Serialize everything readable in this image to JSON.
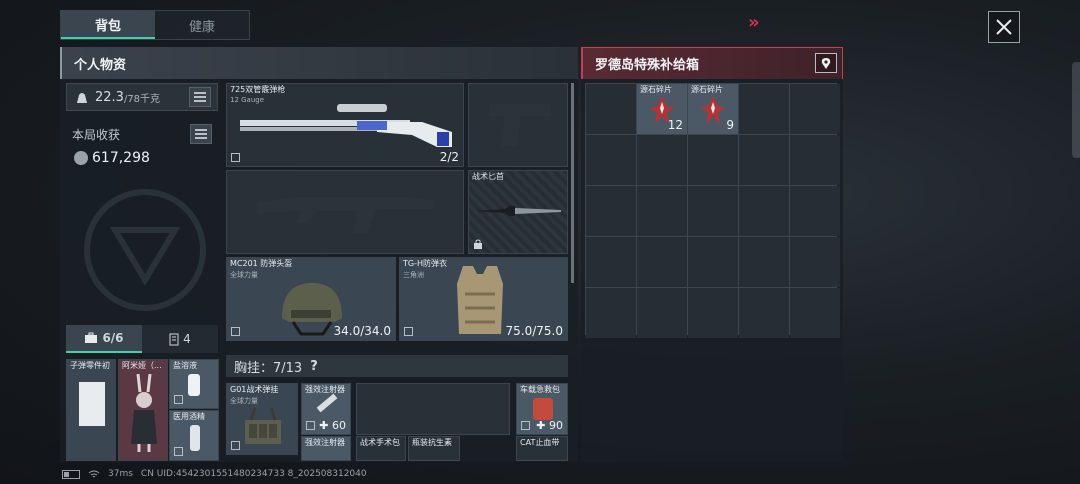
{
  "tabs": [
    {
      "label": "背包"
    },
    {
      "label": "健康"
    }
  ],
  "left_panel": {
    "title": "个人物资",
    "weight_value": "22.3",
    "weight_max": "/78千克",
    "harvest_label": "本局收获",
    "money": "617,298",
    "weapon1": {
      "name": "725双管霰弹枪",
      "sub": "12 Gauge",
      "value": "2/2"
    },
    "knife": {
      "name": "战术匕首"
    },
    "helmet": {
      "name": "MC201 防弹头盔",
      "sub": "全球力量",
      "value": "34.0/34.0"
    },
    "armor": {
      "name": "TG-H防弹衣",
      "sub": "三角洲",
      "value": "75.0/75.0"
    },
    "bag_tabs": [
      {
        "label": "6/6"
      },
      {
        "label": "4"
      }
    ],
    "pocket": {
      "ammo": "子弹零件初",
      "amiya": "阿米娅（...",
      "saline": "盐溶液",
      "alcohol": "医用酒精"
    },
    "vest_header": "胸挂：7/13",
    "vest_help": "?",
    "vest": {
      "name": "G01战术弹挂",
      "sub": "全球力量",
      "injector": "强效注射器",
      "injector_count": "60",
      "car_kit": "车载急救包",
      "car_kit_count": "90",
      "injector2": "强效注射器",
      "surgery": "战术手术包",
      "antibiotic": "瓶装抗生素",
      "cat": "CAT止血带"
    }
  },
  "right_panel": {
    "title": "罗德岛特殊补给箱",
    "items": [
      {
        "label": "源石碎片",
        "count": "12"
      },
      {
        "label": "源石碎片",
        "count": "9"
      }
    ]
  },
  "status": {
    "ping": "37ms",
    "uid": "CN UID:4542301551480234733 8_202508312040"
  }
}
